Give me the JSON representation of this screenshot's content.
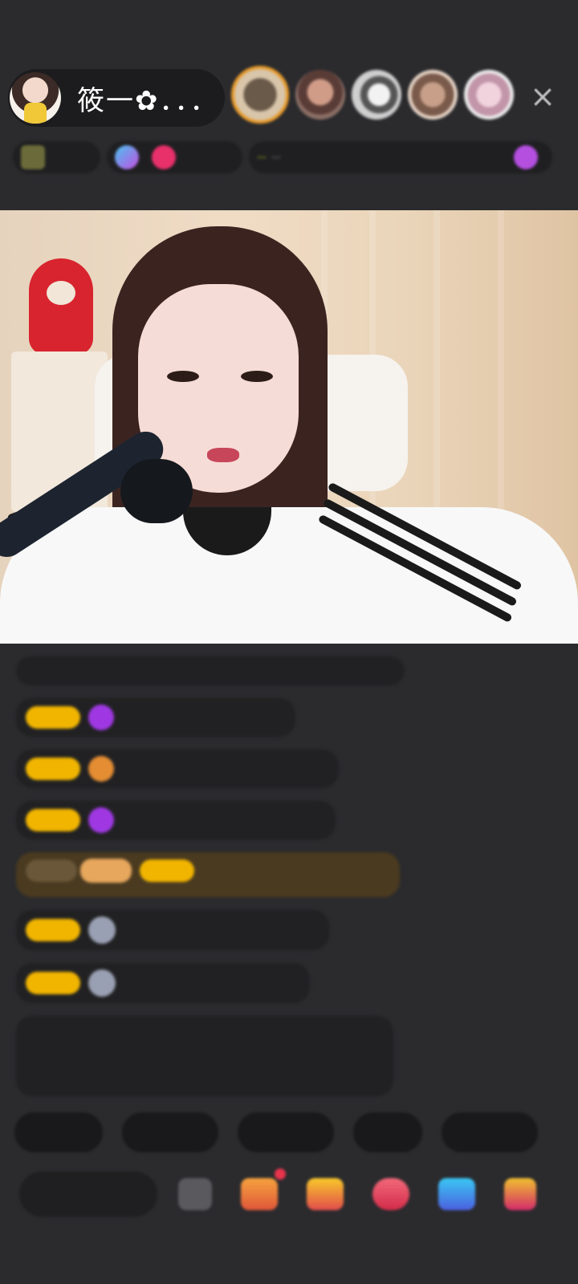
{
  "header": {
    "host_name": "筱一✿．．．",
    "viewers": [
      "viewer-1",
      "viewer-2",
      "viewer-3",
      "viewer-4",
      "viewer-5"
    ],
    "close_icon": "×"
  },
  "info_row": {
    "chips": [
      "",
      "",
      "",
      ""
    ]
  },
  "chat": {
    "system_notice": "",
    "messages": [
      {
        "badge": "",
        "icon": "gem-icon",
        "user": "",
        "text": ""
      },
      {
        "badge": "",
        "icon": "orange-icon",
        "user": "",
        "text": ""
      },
      {
        "badge": "",
        "icon": "gem-icon",
        "user": "",
        "text": ""
      },
      {
        "badge": "",
        "icon": "gold-banner",
        "user": "",
        "text": ""
      },
      {
        "badge": "",
        "icon": "avatar-icon",
        "user": "",
        "text": ""
      },
      {
        "badge": "",
        "icon": "avatar-icon",
        "user": "",
        "text": ""
      }
    ],
    "long_notice": ""
  },
  "quick_replies": [
    "",
    "",
    "",
    "",
    ""
  ],
  "bottom_bar": {
    "say_placeholder": "",
    "icons": [
      "emoji-icon",
      "gift-box-icon",
      "treasure-icon",
      "heart-gift-icon",
      "game-icon",
      "more-gift-icon"
    ]
  },
  "colors": {
    "background": "#2b2b2e",
    "badge_gold": "#f1b500",
    "gem_purple": "#9f38e3",
    "notice_green": "#9bd158"
  }
}
